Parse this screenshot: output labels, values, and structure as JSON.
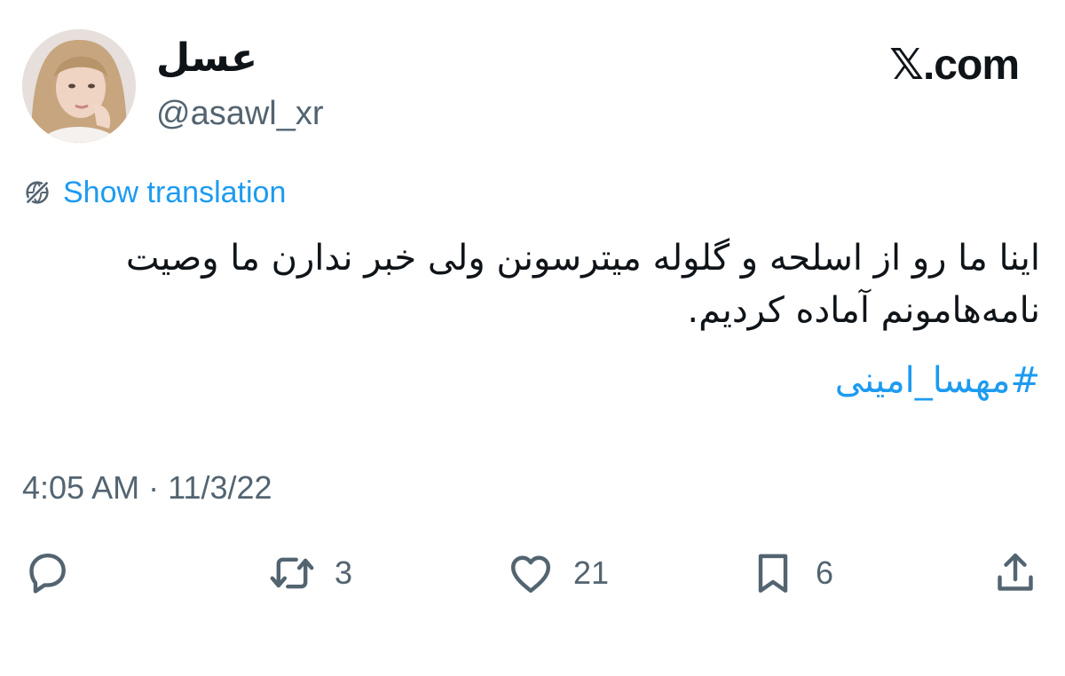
{
  "author": {
    "display_name": "عسل",
    "handle": "@asawl_xr"
  },
  "brand": "𝕏.com",
  "translate": {
    "label": "Show translation",
    "icon": "globe-slash-icon"
  },
  "tweet": {
    "text": "اینا ما رو از اسلحه و گلوله میترسونن ولی خبر ندارن ما وصیت نامه‌هامونم آماده کردیم.",
    "hashtag": "#مهسا_امینی"
  },
  "meta": {
    "time": "4:05 AM",
    "separator": "·",
    "date": "11/3/22"
  },
  "actions": {
    "reply": {
      "icon": "reply-icon"
    },
    "retweet": {
      "icon": "retweet-icon",
      "count": "3"
    },
    "like": {
      "icon": "heart-icon",
      "count": "21"
    },
    "bookmark": {
      "icon": "bookmark-icon",
      "count": "6"
    },
    "share": {
      "icon": "share-icon"
    }
  },
  "colors": {
    "link": "#1d9bf0",
    "muted": "#536471",
    "text": "#0f1419"
  }
}
